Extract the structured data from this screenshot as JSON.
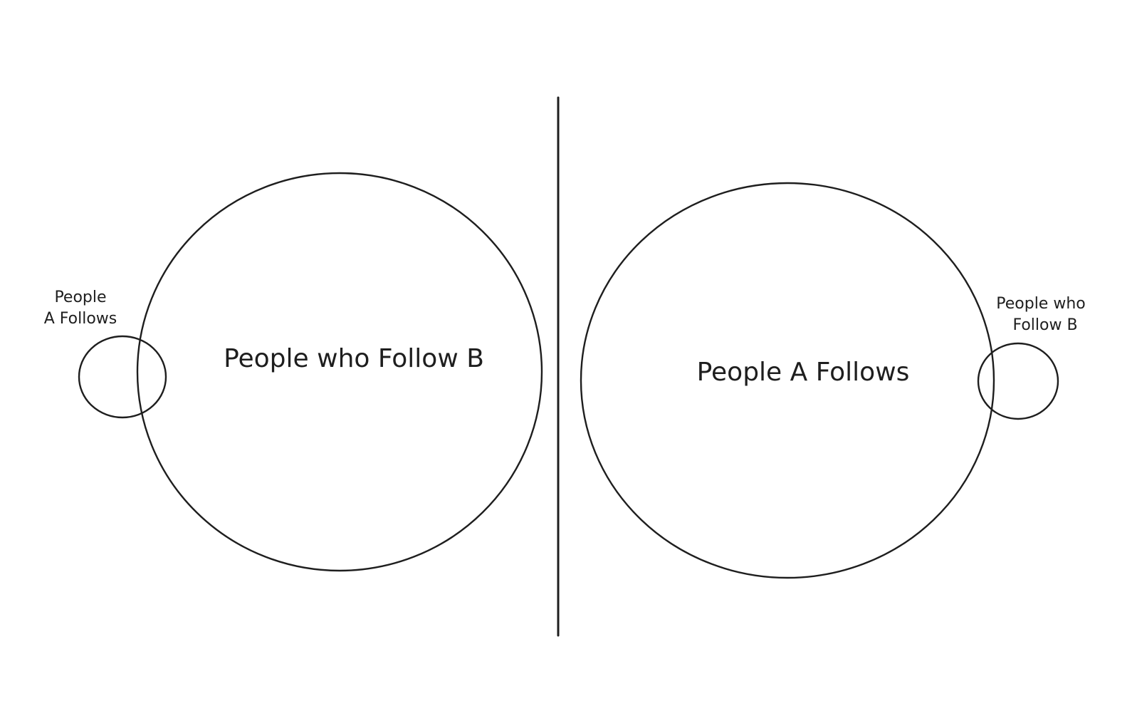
{
  "diagram": {
    "left": {
      "big_label": "People who Follow B",
      "small_label_line1": "People",
      "small_label_line2": "A Follows"
    },
    "right": {
      "big_label": "People A Follows",
      "small_label_line1": "People who",
      "small_label_line2": "Follow B"
    },
    "colors": {
      "stroke": "#1e1e1e",
      "background": "#ffffff"
    }
  }
}
